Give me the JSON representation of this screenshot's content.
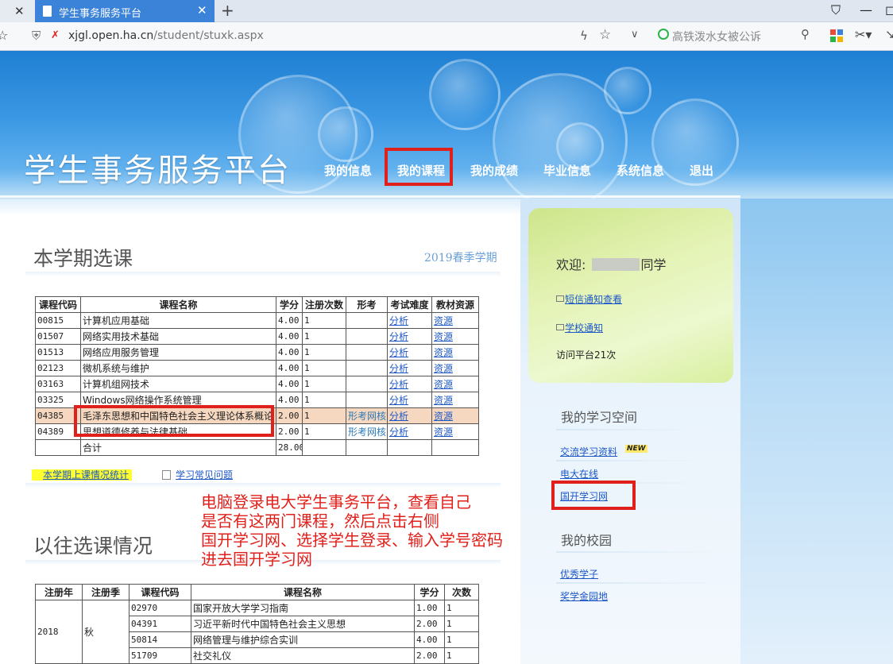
{
  "browser": {
    "active_tab_title": "学生事务服务平台",
    "url_domain": "xjgl.open.ha.cn",
    "url_path": "/student/stuxk.aspx",
    "search_placeholder": "高铁泼水女被公诉"
  },
  "header": {
    "site_title": "学生事务服务平台",
    "nav": [
      "我的信息",
      "我的课程",
      "我的成绩",
      "毕业信息",
      "系统信息",
      "退出"
    ],
    "highlighted_nav": "我的课程"
  },
  "current": {
    "title": "本学期选课",
    "semester": "2019春季学期",
    "columns": [
      "课程代码",
      "课程名称",
      "学分",
      "注册次数",
      "形考",
      "考试难度",
      "教材资源"
    ],
    "rows": [
      {
        "code": "00815",
        "name": "计算机应用基础",
        "credit": "4.00",
        "times": "1",
        "form": "",
        "diff": "分析",
        "res": "资源"
      },
      {
        "code": "01507",
        "name": "网络实用技术基础",
        "credit": "4.00",
        "times": "1",
        "form": "",
        "diff": "分析",
        "res": "资源"
      },
      {
        "code": "01513",
        "name": "网络应用服务管理",
        "credit": "4.00",
        "times": "1",
        "form": "",
        "diff": "分析",
        "res": "资源"
      },
      {
        "code": "02123",
        "name": "微机系统与维护",
        "credit": "4.00",
        "times": "1",
        "form": "",
        "diff": "分析",
        "res": "资源"
      },
      {
        "code": "03163",
        "name": "计算机组网技术",
        "credit": "4.00",
        "times": "1",
        "form": "",
        "diff": "分析",
        "res": "资源"
      },
      {
        "code": "03325",
        "name": "Windows网络操作系统管理",
        "credit": "4.00",
        "times": "1",
        "form": "",
        "diff": "分析",
        "res": "资源"
      },
      {
        "code": "04385",
        "name": "毛泽东思想和中国特色社会主义理论体系概论",
        "credit": "2.00",
        "times": "1",
        "form": "形考网核",
        "diff": "分析",
        "res": "资源"
      },
      {
        "code": "04389",
        "name": "思想道德修养与法律基础",
        "credit": "2.00",
        "times": "1",
        "form": "形考网核",
        "diff": "分析",
        "res": "资源"
      }
    ],
    "total_label": "合计",
    "total_credit": "28.00",
    "links": {
      "attendance": "本学期上课情况统计",
      "faq": "学习常见问题"
    }
  },
  "annotation": [
    "电脑登录电大学生事务平台，查看自己",
    "是否有这两门课程，然后点击右侧",
    "国开学习网、选择学生登录、输入学号密码",
    "进去国开学习网"
  ],
  "past": {
    "title": "以往选课情况",
    "columns": [
      "注册年",
      "注册季",
      "课程代码",
      "课程名称",
      "学分",
      "次数"
    ],
    "year": "2018",
    "season": "秋",
    "rows": [
      {
        "code": "02970",
        "name": "国家开放大学学习指南",
        "credit": "1.00",
        "times": "1"
      },
      {
        "code": "04391",
        "name": "习近平新时代中国特色社会主义思想",
        "credit": "2.00",
        "times": "1"
      },
      {
        "code": "50814",
        "name": "网络管理与维护综合实训",
        "credit": "4.00",
        "times": "1"
      },
      {
        "code": "51709",
        "name": "社交礼仪",
        "credit": "2.00",
        "times": "1"
      }
    ]
  },
  "sidebar": {
    "welcome_prefix": "欢迎:",
    "welcome_suffix": "同学",
    "sms_link": "短信通知查看",
    "notice_link": "学校通知",
    "visit_text": "访问平台21次",
    "space_title": "我的学习空间",
    "space_links": [
      "交流学习资料",
      "电大在线",
      "国开学习网"
    ],
    "new_badge": "NEW",
    "campus_title": "我的校园",
    "campus_links": [
      "优秀学子",
      "奖学金园地"
    ]
  },
  "colors": {
    "annotation_red": "#e0201b",
    "tab_blue": "#3b83d8",
    "link_blue": "#1d58c6"
  }
}
